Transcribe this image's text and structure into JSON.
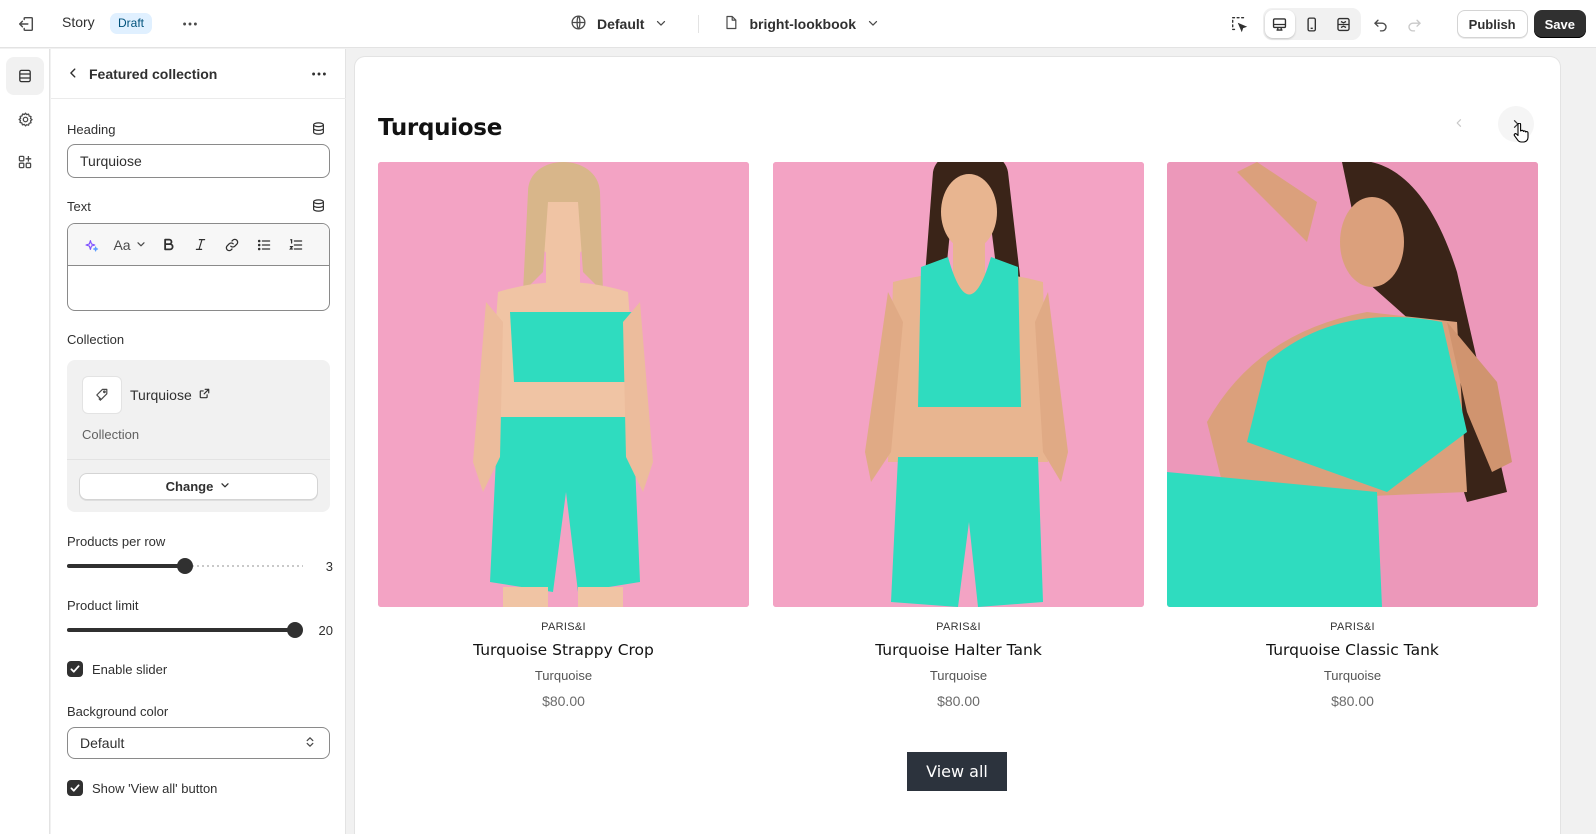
{
  "topbar": {
    "story_label": "Story",
    "status_badge": "Draft",
    "theme_label": "Default",
    "template_label": "bright-lookbook",
    "publish_label": "Publish",
    "save_label": "Save"
  },
  "panel": {
    "title": "Featured collection",
    "heading_label": "Heading",
    "heading_value": "Turquiose",
    "text_label": "Text",
    "rte_font_label": "Aa",
    "collection_label": "Collection",
    "collection_name": "Turquiose",
    "collection_type": "Collection",
    "change_label": "Change",
    "products_per_row_label": "Products per row",
    "products_per_row_value": "3",
    "products_per_row_fraction": 0.5,
    "product_limit_label": "Product limit",
    "product_limit_value": "20",
    "product_limit_fraction": 1.0,
    "enable_slider_label": "Enable slider",
    "enable_slider_checked": true,
    "background_color_label": "Background color",
    "background_color_value": "Default",
    "show_view_all_label": "Show 'View all' button",
    "show_view_all_checked": true
  },
  "preview": {
    "heading": "Turquiose",
    "view_all_label": "View all",
    "products": [
      {
        "vendor": "PARIS&I",
        "title": "Turquoise Strappy Crop",
        "variant": "Turquoise",
        "price": "$80.00"
      },
      {
        "vendor": "PARIS&I",
        "title": "Turquoise Halter Tank",
        "variant": "Turquoise",
        "price": "$80.00"
      },
      {
        "vendor": "PARIS&I",
        "title": "Turquoise Classic Tank",
        "variant": "Turquoise",
        "price": "$80.00"
      }
    ]
  },
  "colors": {
    "accent_dark": "#303030",
    "draft_badge_bg": "#e0f0ff",
    "product_bg_pink": "#f3a3c4",
    "product_turquoise": "#2fdcbf",
    "view_all_bg": "#2c333d"
  },
  "icons": [
    "exit-icon",
    "more-icon",
    "globe-icon",
    "page-icon",
    "chevron-down-icon",
    "inspector-icon",
    "desktop-icon",
    "mobile-icon",
    "fullwidth-icon",
    "undo-icon",
    "redo-icon",
    "sections-icon",
    "settings-icon",
    "apps-icon",
    "back-icon",
    "database-icon",
    "sparkle-icon",
    "bold-icon",
    "italic-icon",
    "link-icon",
    "bullet-list-icon",
    "numbered-list-icon",
    "tag-icon",
    "external-link-icon",
    "checkmark-icon",
    "select-arrows-icon",
    "arrow-left-icon",
    "arrow-right-icon",
    "hand-cursor-icon"
  ]
}
